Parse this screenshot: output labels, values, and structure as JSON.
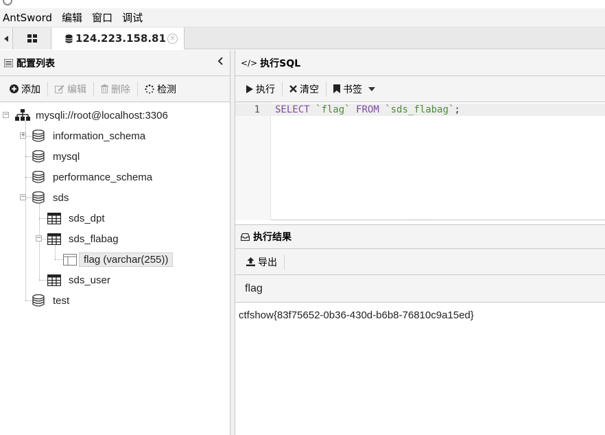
{
  "menubar": {
    "items": [
      "AntSword",
      "编辑",
      "窗口",
      "调试"
    ]
  },
  "tabs": {
    "home_icon": "grid-icon",
    "connection_label": "124.223.158.81"
  },
  "left_panel": {
    "title": "配置列表",
    "toolbar": {
      "add": "添加",
      "edit": "编辑",
      "delete": "删除",
      "detect": "检测"
    },
    "tree": {
      "root": "mysqli://root@localhost:3306",
      "databases": [
        {
          "name": "information_schema"
        },
        {
          "name": "mysql"
        },
        {
          "name": "performance_schema"
        },
        {
          "name": "sds"
        },
        {
          "name": "test"
        }
      ],
      "sds_tables": [
        {
          "name": "sds_dpt"
        },
        {
          "name": "sds_flabag"
        },
        {
          "name": "sds_user"
        }
      ],
      "column": "flag (varchar(255))"
    }
  },
  "sql_panel": {
    "title": "执行SQL",
    "toolbar": {
      "run": "执行",
      "clear": "清空",
      "bookmark": "书签"
    },
    "editor": {
      "line_number": "1",
      "tokens": {
        "select": "SELECT",
        "col": "`flag`",
        "from": "FROM",
        "table": "`sds_flabag`",
        "end": ";"
      }
    }
  },
  "result_panel": {
    "title": "执行结果",
    "toolbar": {
      "export": "导出"
    },
    "column_header": "flag",
    "rows": [
      "ctfshow{83f75652-0b36-430d-b6b8-76810c9a15ed}"
    ]
  }
}
